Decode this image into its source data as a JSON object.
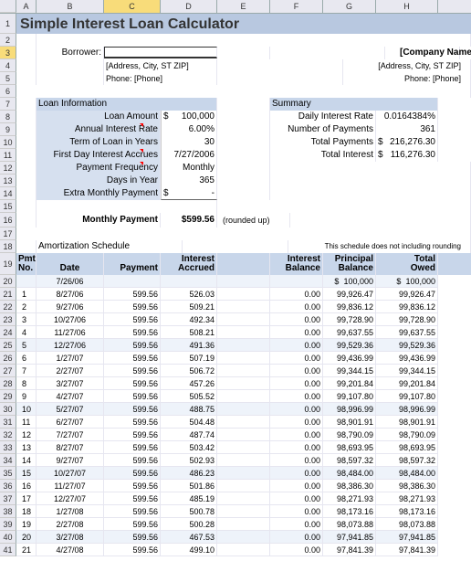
{
  "columns": [
    "A",
    "B",
    "C",
    "D",
    "E",
    "F",
    "G",
    "H"
  ],
  "rows": 41,
  "title": "Simple Interest Loan Calculator",
  "borrower": {
    "label": "Borrower:",
    "value": ""
  },
  "contact_left": {
    "address": "[Address, City, ST ZIP]",
    "phone": "Phone: [Phone]"
  },
  "contact_right": {
    "company": "[Company Name]",
    "address": "[Address, City, ST  ZIP]",
    "phone": "Phone: [Phone]"
  },
  "loan_info": {
    "header": "Loan Information",
    "items": [
      {
        "label": "Loan Amount",
        "prefix": "$",
        "value": "100,000"
      },
      {
        "label": "Annual Interest Rate",
        "prefix": "",
        "value": "6.00%"
      },
      {
        "label": "Term of Loan in Years",
        "prefix": "",
        "value": "30"
      },
      {
        "label": "First Day Interest Accrues",
        "prefix": "",
        "value": "7/27/2006"
      },
      {
        "label": "Payment Frequency",
        "prefix": "",
        "value": "Monthly"
      },
      {
        "label": "Days in Year",
        "prefix": "",
        "value": "365"
      },
      {
        "label": "Extra Monthly Payment",
        "prefix": "$",
        "value": "-"
      }
    ]
  },
  "summary": {
    "header": "Summary",
    "items": [
      {
        "label": "Daily Interest Rate",
        "prefix": "",
        "value": "0.0164384%"
      },
      {
        "label": "Number of Payments",
        "prefix": "",
        "value": "361"
      },
      {
        "label": "Total Payments",
        "prefix": "$",
        "value": "216,276.30"
      },
      {
        "label": "Total Interest",
        "prefix": "$",
        "value": "116,276.30"
      }
    ]
  },
  "monthly": {
    "label": "Monthly Payment",
    "value": "$599.56",
    "note": "(rounded up)"
  },
  "schedule_title": "Amortization Schedule",
  "schedule_note": "This schedule does not including rounding",
  "schedule_headers": {
    "pmt": "Pmt\nNo.",
    "date": "Date",
    "payment": "Payment",
    "interest_accrued": "Interest\nAccrued",
    "interest_balance": "Interest\nBalance",
    "principal_balance": "Principal\nBalance",
    "total_owed": "Total\nOwed"
  },
  "chart_data": {
    "type": "table",
    "columns": [
      "Pmt No.",
      "Date",
      "Payment",
      "Interest Accrued",
      "Interest Balance",
      "Principal Balance",
      "Total Owed"
    ],
    "initial": {
      "date": "7/26/06",
      "principal_prefix": "$",
      "principal": "100,000",
      "owed_prefix": "$",
      "owed": "100,000"
    },
    "rows": [
      {
        "n": 1,
        "date": "8/27/06",
        "pmt": "599.56",
        "int_acc": "526.03",
        "int_bal": "0.00",
        "prin_bal": "99,926.47",
        "owed": "99,926.47"
      },
      {
        "n": 2,
        "date": "9/27/06",
        "pmt": "599.56",
        "int_acc": "509.21",
        "int_bal": "0.00",
        "prin_bal": "99,836.12",
        "owed": "99,836.12"
      },
      {
        "n": 3,
        "date": "10/27/06",
        "pmt": "599.56",
        "int_acc": "492.34",
        "int_bal": "0.00",
        "prin_bal": "99,728.90",
        "owed": "99,728.90"
      },
      {
        "n": 4,
        "date": "11/27/06",
        "pmt": "599.56",
        "int_acc": "508.21",
        "int_bal": "0.00",
        "prin_bal": "99,637.55",
        "owed": "99,637.55"
      },
      {
        "n": 5,
        "date": "12/27/06",
        "pmt": "599.56",
        "int_acc": "491.36",
        "int_bal": "0.00",
        "prin_bal": "99,529.36",
        "owed": "99,529.36"
      },
      {
        "n": 6,
        "date": "1/27/07",
        "pmt": "599.56",
        "int_acc": "507.19",
        "int_bal": "0.00",
        "prin_bal": "99,436.99",
        "owed": "99,436.99"
      },
      {
        "n": 7,
        "date": "2/27/07",
        "pmt": "599.56",
        "int_acc": "506.72",
        "int_bal": "0.00",
        "prin_bal": "99,344.15",
        "owed": "99,344.15"
      },
      {
        "n": 8,
        "date": "3/27/07",
        "pmt": "599.56",
        "int_acc": "457.26",
        "int_bal": "0.00",
        "prin_bal": "99,201.84",
        "owed": "99,201.84"
      },
      {
        "n": 9,
        "date": "4/27/07",
        "pmt": "599.56",
        "int_acc": "505.52",
        "int_bal": "0.00",
        "prin_bal": "99,107.80",
        "owed": "99,107.80"
      },
      {
        "n": 10,
        "date": "5/27/07",
        "pmt": "599.56",
        "int_acc": "488.75",
        "int_bal": "0.00",
        "prin_bal": "98,996.99",
        "owed": "98,996.99"
      },
      {
        "n": 11,
        "date": "6/27/07",
        "pmt": "599.56",
        "int_acc": "504.48",
        "int_bal": "0.00",
        "prin_bal": "98,901.91",
        "owed": "98,901.91"
      },
      {
        "n": 12,
        "date": "7/27/07",
        "pmt": "599.56",
        "int_acc": "487.74",
        "int_bal": "0.00",
        "prin_bal": "98,790.09",
        "owed": "98,790.09"
      },
      {
        "n": 13,
        "date": "8/27/07",
        "pmt": "599.56",
        "int_acc": "503.42",
        "int_bal": "0.00",
        "prin_bal": "98,693.95",
        "owed": "98,693.95"
      },
      {
        "n": 14,
        "date": "9/27/07",
        "pmt": "599.56",
        "int_acc": "502.93",
        "int_bal": "0.00",
        "prin_bal": "98,597.32",
        "owed": "98,597.32"
      },
      {
        "n": 15,
        "date": "10/27/07",
        "pmt": "599.56",
        "int_acc": "486.23",
        "int_bal": "0.00",
        "prin_bal": "98,484.00",
        "owed": "98,484.00"
      },
      {
        "n": 16,
        "date": "11/27/07",
        "pmt": "599.56",
        "int_acc": "501.86",
        "int_bal": "0.00",
        "prin_bal": "98,386.30",
        "owed": "98,386.30"
      },
      {
        "n": 17,
        "date": "12/27/07",
        "pmt": "599.56",
        "int_acc": "485.19",
        "int_bal": "0.00",
        "prin_bal": "98,271.93",
        "owed": "98,271.93"
      },
      {
        "n": 18,
        "date": "1/27/08",
        "pmt": "599.56",
        "int_acc": "500.78",
        "int_bal": "0.00",
        "prin_bal": "98,173.16",
        "owed": "98,173.16"
      },
      {
        "n": 19,
        "date": "2/27/08",
        "pmt": "599.56",
        "int_acc": "500.28",
        "int_bal": "0.00",
        "prin_bal": "98,073.88",
        "owed": "98,073.88"
      },
      {
        "n": 20,
        "date": "3/27/08",
        "pmt": "599.56",
        "int_acc": "467.53",
        "int_bal": "0.00",
        "prin_bal": "97,941.85",
        "owed": "97,941.85"
      },
      {
        "n": 21,
        "date": "4/27/08",
        "pmt": "599.56",
        "int_acc": "499.10",
        "int_bal": "0.00",
        "prin_bal": "97,841.39",
        "owed": "97,841.39"
      }
    ]
  }
}
